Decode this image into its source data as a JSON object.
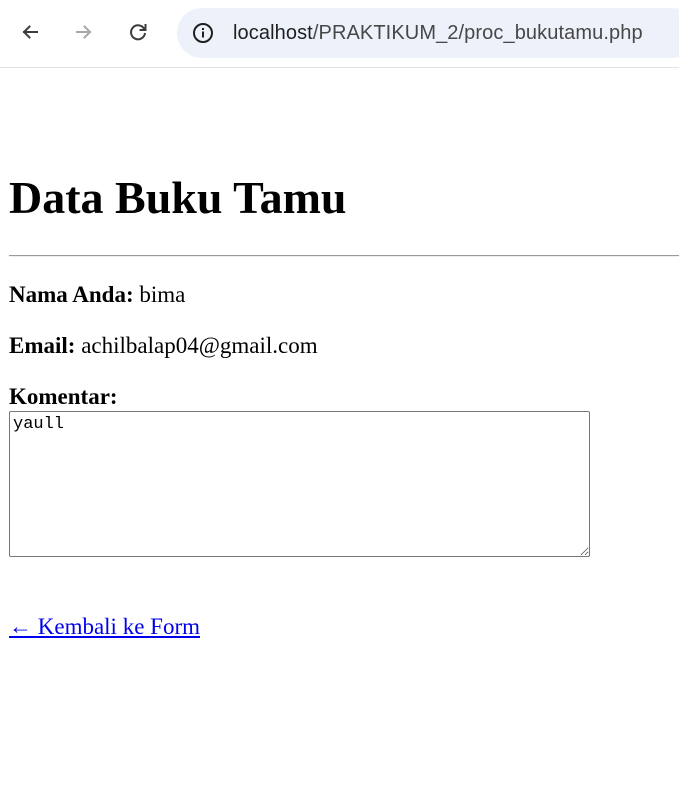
{
  "browser": {
    "url_host": "localhost",
    "url_path": "/PRAKTIKUM_2/proc_bukutamu.php",
    "icons": {
      "back": "arrow-left-icon",
      "forward": "arrow-right-icon",
      "reload": "reload-icon",
      "site_info": "info-circle-icon"
    }
  },
  "page": {
    "title": "Data Buku Tamu",
    "fields": {
      "nama_label": "Nama Anda:",
      "nama_value": "bima",
      "email_label": "Email:",
      "email_value": "achilbalap04@gmail.com",
      "komentar_label": "Komentar:",
      "komentar_value": "yaull"
    },
    "back_link": "← Kembali ke Form"
  },
  "colors": {
    "link": "#0000ee",
    "omnibox_bg": "#edf2fa"
  }
}
